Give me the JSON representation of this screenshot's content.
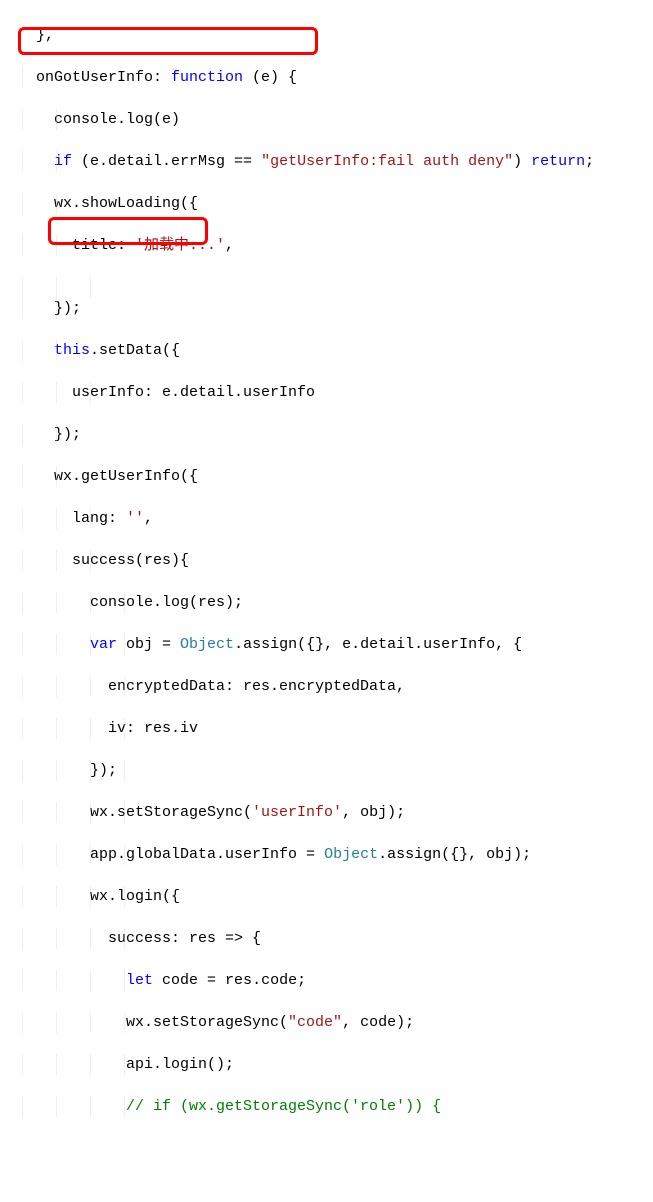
{
  "code": {
    "l0": "  },",
    "l1a": "  onGotUserInfo: ",
    "l1b": "function",
    "l1c": " (e) {",
    "l2": "    console.log(e)",
    "l3a": "    ",
    "l3b": "if",
    "l3c": " (e.detail.errMsg == ",
    "l3d": "\"getUserInfo:fail auth deny\"",
    "l3e": ") ",
    "l3f": "return",
    "l3g": ";",
    "l4": "    wx.showLoading({",
    "l5a": "      title: ",
    "l5b": "'加载中...'",
    "l5c": ",",
    "l6": "",
    "l7": "    });",
    "l8a": "    ",
    "l8b": "this",
    "l8c": ".setData({",
    "l9": "      userInfo: e.detail.userInfo",
    "l10": "    });",
    "l11": "    wx.getUserInfo({",
    "l12a": "      lang: ",
    "l12b": "''",
    "l12c": ",",
    "l13": "      success(res){",
    "l14": "        console.log(res);",
    "l15a": "        ",
    "l15b": "var",
    "l15c": " obj = ",
    "l15d": "Object",
    "l15e": ".assign({}, e.detail.userInfo, {",
    "l16": "          encryptedData: res.encryptedData,",
    "l17": "          iv: res.iv",
    "l18": "        });",
    "l19a": "        wx.setStorageSync(",
    "l19b": "'userInfo'",
    "l19c": ", obj);",
    "l20a": "        app.globalData.userInfo = ",
    "l20b": "Object",
    "l20c": ".assign({}, obj);",
    "l21": "        wx.login({",
    "l22": "          success: res => {",
    "l23a": "            ",
    "l23b": "let",
    "l23c": " code = res.code;",
    "l24a": "            wx.setStorageSync(",
    "l24b": "\"code\"",
    "l24c": ", code);",
    "l25": "            api.login();",
    "l26": "            // if (wx.getStorageSync('role')) {"
  }
}
